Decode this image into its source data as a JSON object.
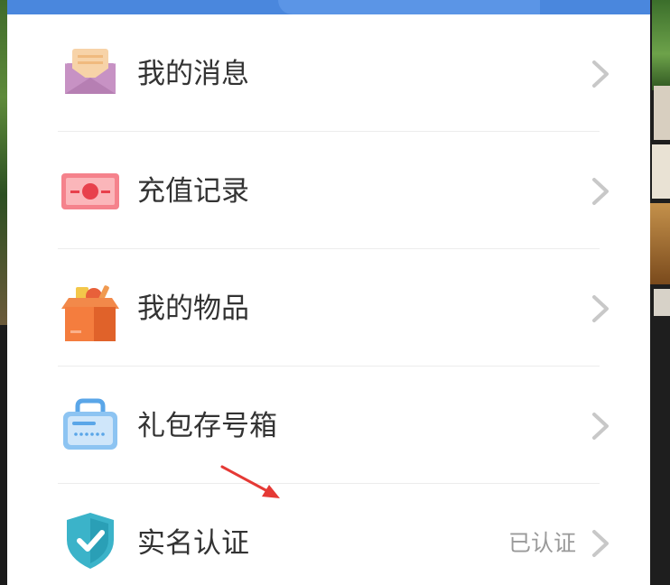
{
  "menu": {
    "items": [
      {
        "label": "我的消息",
        "icon": "envelope-icon",
        "status": ""
      },
      {
        "label": "充值记录",
        "icon": "ticket-icon",
        "status": ""
      },
      {
        "label": "我的物品",
        "icon": "box-icon",
        "status": ""
      },
      {
        "label": "礼包存号箱",
        "icon": "gift-box-case-icon",
        "status": ""
      },
      {
        "label": "实名认证",
        "icon": "shield-check-icon",
        "status": "已认证"
      }
    ]
  },
  "colors": {
    "header": "#4a87dd",
    "text": "#333333",
    "status": "#9a9a9a",
    "chevron": "#c8c8c8",
    "annotation": "#e53935"
  }
}
